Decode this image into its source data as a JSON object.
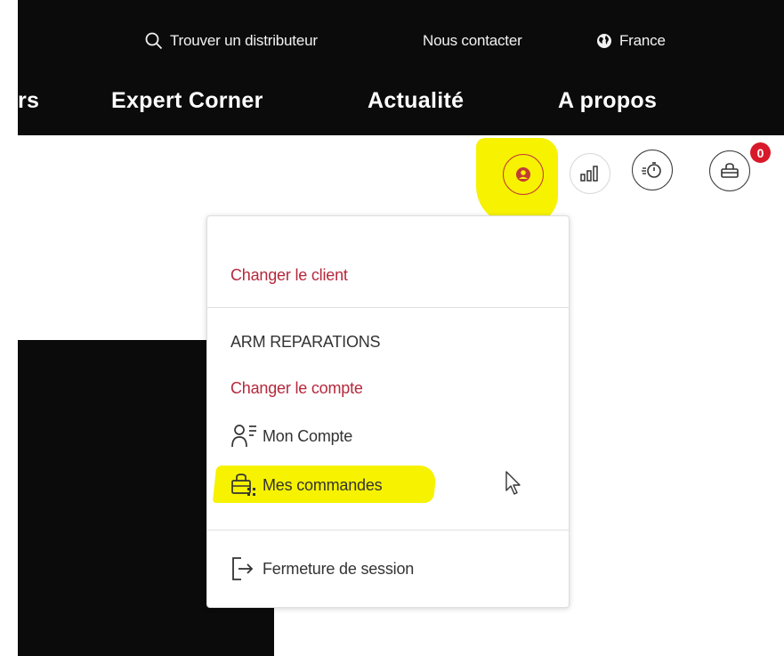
{
  "header": {
    "utility": {
      "find_distributor": "Trouver un distributeur",
      "contact": "Nous contacter",
      "country": "France"
    },
    "nav": {
      "partial_item": "rs",
      "expert_corner": "Expert Corner",
      "news": "Actualité",
      "about": "A propos"
    }
  },
  "icons": {
    "account": "user-circle-icon",
    "compare": "bar-chart-icon",
    "timer": "stopwatch-icon",
    "cart": "basket-icon",
    "cart_count": "0"
  },
  "dropdown": {
    "change_client": "Changer le client",
    "company_name": "ARM REPARATIONS",
    "change_account": "Changer le compte",
    "my_account": "Mon Compte",
    "my_orders": "Mes commandes",
    "logout": "Fermeture de session"
  },
  "colors": {
    "brand_red": "#b6283c",
    "highlight": "#f6f200",
    "header_bg": "#0b0b0b",
    "badge": "#d8192a"
  }
}
